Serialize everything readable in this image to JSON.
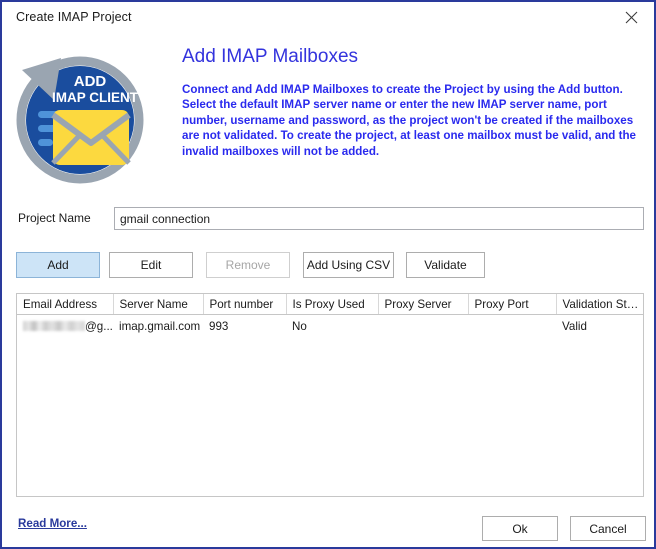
{
  "window": {
    "title": "Create IMAP Project",
    "close_icon": "close-icon",
    "border_color": "#2a3a9c"
  },
  "header": {
    "title": "Add IMAP Mailboxes",
    "title_color": "#3333dd",
    "description": "Connect and Add IMAP Mailboxes to create the Project by using the Add button. Select the default IMAP server name or enter the new IMAP server name, port number, username and password, as the project won't be created if the mailboxes are not validated. To create the project, at least one mailbox must be valid, and the invalid mailboxes will not be added.",
    "description_color": "#2a2aee",
    "logo": {
      "icon": "add-imap-client-logo",
      "line1": "ADD",
      "line2": "IMAP CLIENT",
      "circle_color": "#1a4d9e",
      "ring_color": "#9aa5b1",
      "envelope_color": "#fcd93f"
    }
  },
  "project": {
    "label": "Project Name",
    "value": "gmail connection",
    "placeholder": ""
  },
  "toolbar": {
    "add_label": "Add",
    "edit_label": "Edit",
    "remove_label": "Remove",
    "csv_label": "Add Using CSV",
    "validate_label": "Validate",
    "highlight_color": "#cde4f7"
  },
  "grid": {
    "columns": [
      "Email Address",
      "Server Name",
      "Port number",
      "Is Proxy Used",
      "Proxy Server",
      "Proxy Port",
      "Validation Stat..."
    ],
    "rows": [
      {
        "email_redacted": true,
        "email_suffix": "@g...",
        "server_name": "imap.gmail.com",
        "port_number": "993",
        "is_proxy_used": "No",
        "proxy_server": "",
        "proxy_port": "",
        "validation_status": "Valid"
      }
    ]
  },
  "footer": {
    "read_more_label": "Read More...",
    "read_more_color": "#2a3a9c",
    "ok_label": "Ok",
    "cancel_label": "Cancel"
  }
}
